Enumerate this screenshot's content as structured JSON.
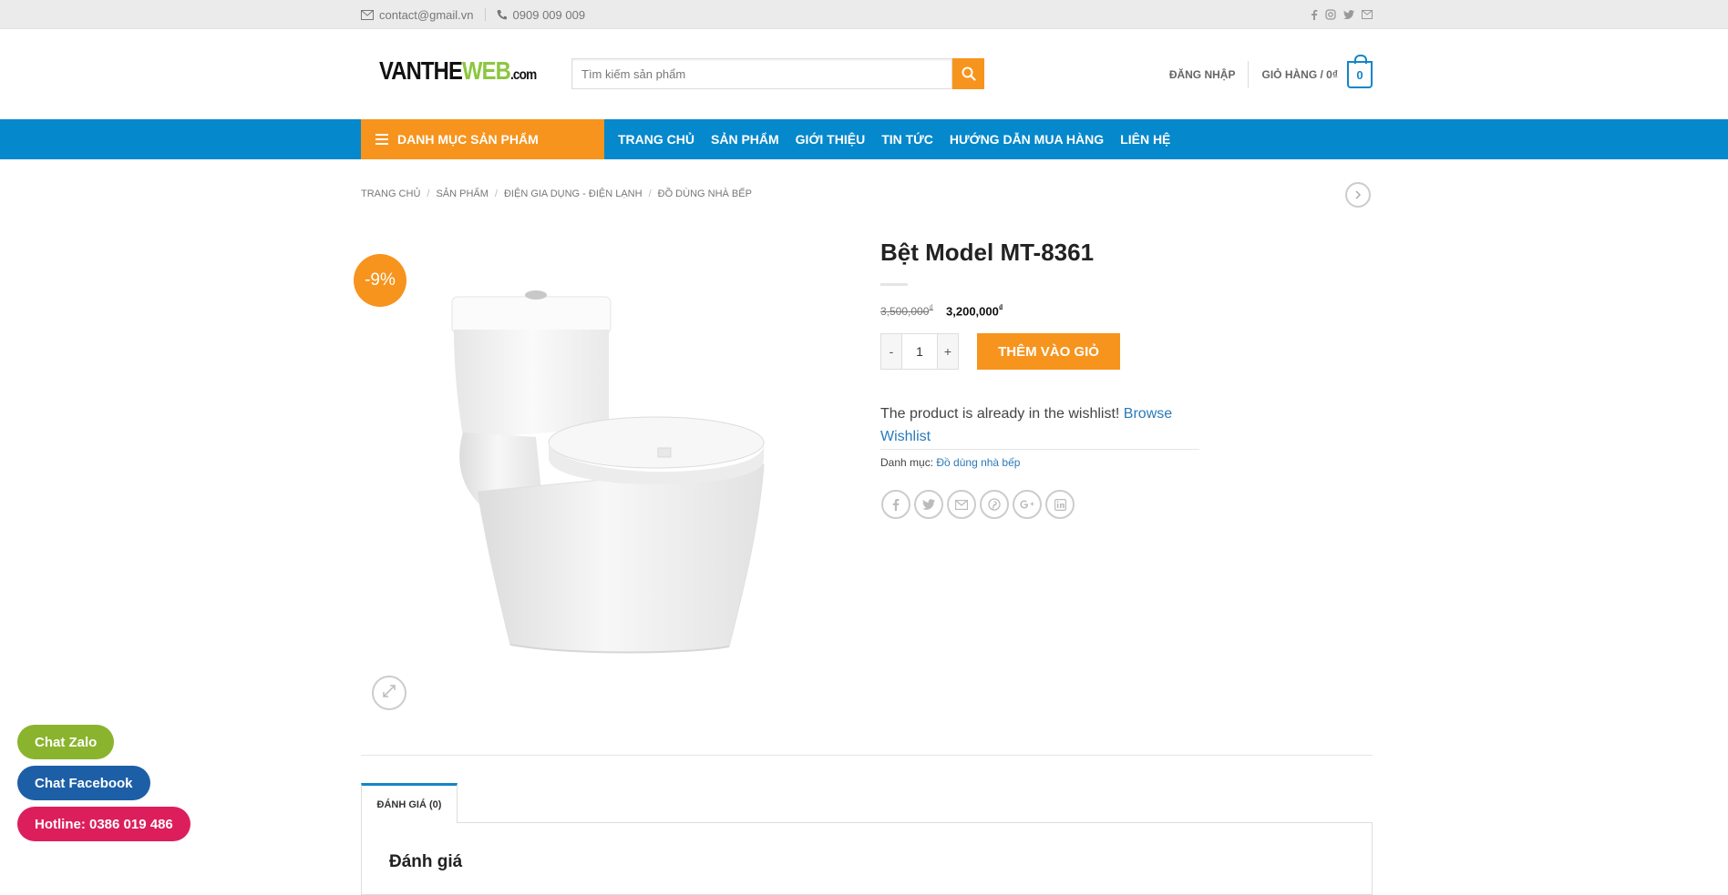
{
  "topbar": {
    "email": "contact@gmail.vn",
    "phone": "0909 009 009",
    "social_icons": [
      "facebook-icon",
      "instagram-icon",
      "twitter-icon",
      "envelope-icon"
    ]
  },
  "header": {
    "logo": {
      "part1": "VANTHE",
      "part2": "WEB",
      "part3": ".com"
    },
    "search_placeholder": "Tìm kiếm sản phẩm",
    "login_label": "ĐĂNG NHẬP",
    "cart_label": "GIỎ HÀNG / 0₫",
    "cart_count": "0"
  },
  "nav": {
    "category_label": "DANH MỤC SẢN PHẨM",
    "items": [
      "TRANG CHỦ",
      "SẢN PHẨM",
      "GIỚI THIỆU",
      "TIN TỨC",
      "HƯỚNG DẪN MUA HÀNG",
      "LIÊN HỆ"
    ]
  },
  "breadcrumb": [
    "TRANG CHỦ",
    "SẢN PHẨM",
    "ĐIỆN GIA DỤNG - ĐIỆN LẠNH",
    "ĐỒ DÙNG NHÀ BẾP"
  ],
  "product": {
    "badge": "-9%",
    "title": "Bệt Model MT-8361",
    "old_price": "3,500,000",
    "new_price": "3,200,000",
    "currency": "₫",
    "quantity": "1",
    "minus": "-",
    "plus": "+",
    "add_to_cart": "THÊM VÀO GIỎ",
    "wishlist_text": "The product is already in the wishlist!",
    "wishlist_link": "Browse Wishlist",
    "category_label": "Danh mục:",
    "category_value": "Đồ dùng nhà bếp",
    "share_icons": [
      "facebook-icon",
      "twitter-icon",
      "envelope-icon",
      "pinterest-icon",
      "google-plus-icon",
      "linkedin-icon"
    ]
  },
  "tabs": {
    "reviews_tab": "ĐÁNH GIÁ (0)",
    "reviews_heading": "Đánh giá"
  },
  "floating": {
    "zalo": "Chat Zalo",
    "facebook": "Chat Facebook",
    "hotline": "Hotline: 0386 019 486"
  },
  "colors": {
    "primary_blue": "#0588cc",
    "accent_orange": "#f7941d",
    "zalo_green": "#8ab42d",
    "facebook_blue": "#1d5fa7",
    "hotline_pink": "#dd1e5d"
  }
}
